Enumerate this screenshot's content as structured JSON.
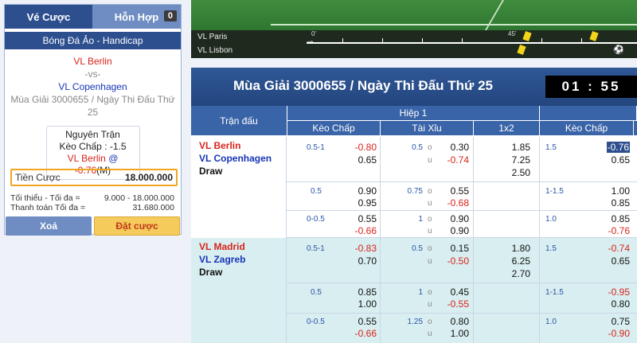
{
  "slip": {
    "tab_active": "Vé Cược",
    "tab_inactive": "Hỗn Hợp",
    "tab_count": "0",
    "title": "Bóng Đá Ảo - Handicap",
    "home": "VL Berlin",
    "vs": "-vs-",
    "away": "VL Copenhagen",
    "season": "Mùa Giải 3000655 / Ngày Thi Đấu Thứ 25",
    "market": "Nguyên Trận",
    "handicap": "Kèo Chấp : -1.5",
    "pick_team": "VL Berlin",
    "pick_at": "@",
    "pick_odds": "-0.76",
    "pick_type": "(M)",
    "stake_label": "Tiền Cược",
    "stake_value": "18.000.000",
    "min_max_label": "Tối thiểu - Tối đa =",
    "min_max_value": "9.000 - 18.000.000",
    "payout_label": "Thanh toán Tối đa =",
    "payout_value": "31.680.000",
    "clear_label": "Xoá",
    "bet_label": "Đặt cược"
  },
  "video": {
    "team_top": "VL Paris",
    "team_bottom": "VL Lisbon",
    "start_label": "0'",
    "mid_label": "45'"
  },
  "board": {
    "title": "Mùa Giải 3000655 / Ngày Thi Đấu Thứ 25",
    "timer": "01 : 55",
    "col_match": "Trận đấu",
    "col_half1": "Hiệp 1",
    "col_handicap": "Kèo Chấp",
    "col_ou": "Tài Xỉu",
    "col_1x2": "1x2",
    "col_handicap2": "Kèo Chấp",
    "ou_over": "o",
    "ou_under": "u",
    "matches": [
      {
        "home": "VL Berlin",
        "away": "VL Copenhagen",
        "draw": "Draw",
        "rows": [
          {
            "hc": "0.5-1",
            "hc_home": "-0.80",
            "hc_away": "0.65",
            "ou": "0.5",
            "ou_over": "0.30",
            "ou_under": "-0.74",
            "x1": "1.85",
            "x2": "7.25",
            "x3": "2.50",
            "hc2": "1.5",
            "hc2_home": "-0.76",
            "hc2_away": "0.65"
          },
          {
            "hc": "0.5",
            "hc_home": "0.90",
            "hc_away": "0.95",
            "ou": "0.75",
            "ou_over": "0.55",
            "ou_under": "-0.68",
            "hc2": "1-1.5",
            "hc2_home": "1.00",
            "hc2_away": "0.85"
          },
          {
            "hc": "0-0.5",
            "hc_home": "0.55",
            "hc_away": "-0.66",
            "ou": "1",
            "ou_over": "0.90",
            "ou_under": "0.90",
            "hc2": "1.0",
            "hc2_home": "0.85",
            "hc2_away": "-0.76"
          }
        ]
      },
      {
        "home": "VL Madrid",
        "away": "VL Zagreb",
        "draw": "Draw",
        "rows": [
          {
            "hc": "0.5-1",
            "hc_home": "-0.83",
            "hc_away": "0.70",
            "ou": "0.5",
            "ou_over": "0.15",
            "ou_under": "-0.50",
            "x1": "1.80",
            "x2": "6.25",
            "x3": "2.70",
            "hc2": "1.5",
            "hc2_home": "-0.74",
            "hc2_away": "0.65"
          },
          {
            "hc": "0.5",
            "hc_home": "0.85",
            "hc_away": "1.00",
            "ou": "1",
            "ou_over": "0.45",
            "ou_under": "-0.55",
            "hc2": "1-1.5",
            "hc2_home": "-0.95",
            "hc2_away": "0.80"
          },
          {
            "hc": "0-0.5",
            "hc_home": "0.55",
            "hc_away": "-0.66",
            "ou": "1.25",
            "ou_over": "0.80",
            "ou_under": "1.00",
            "hc2": "1.0",
            "hc2_home": "0.75",
            "hc2_away": "-0.90"
          }
        ]
      }
    ]
  }
}
